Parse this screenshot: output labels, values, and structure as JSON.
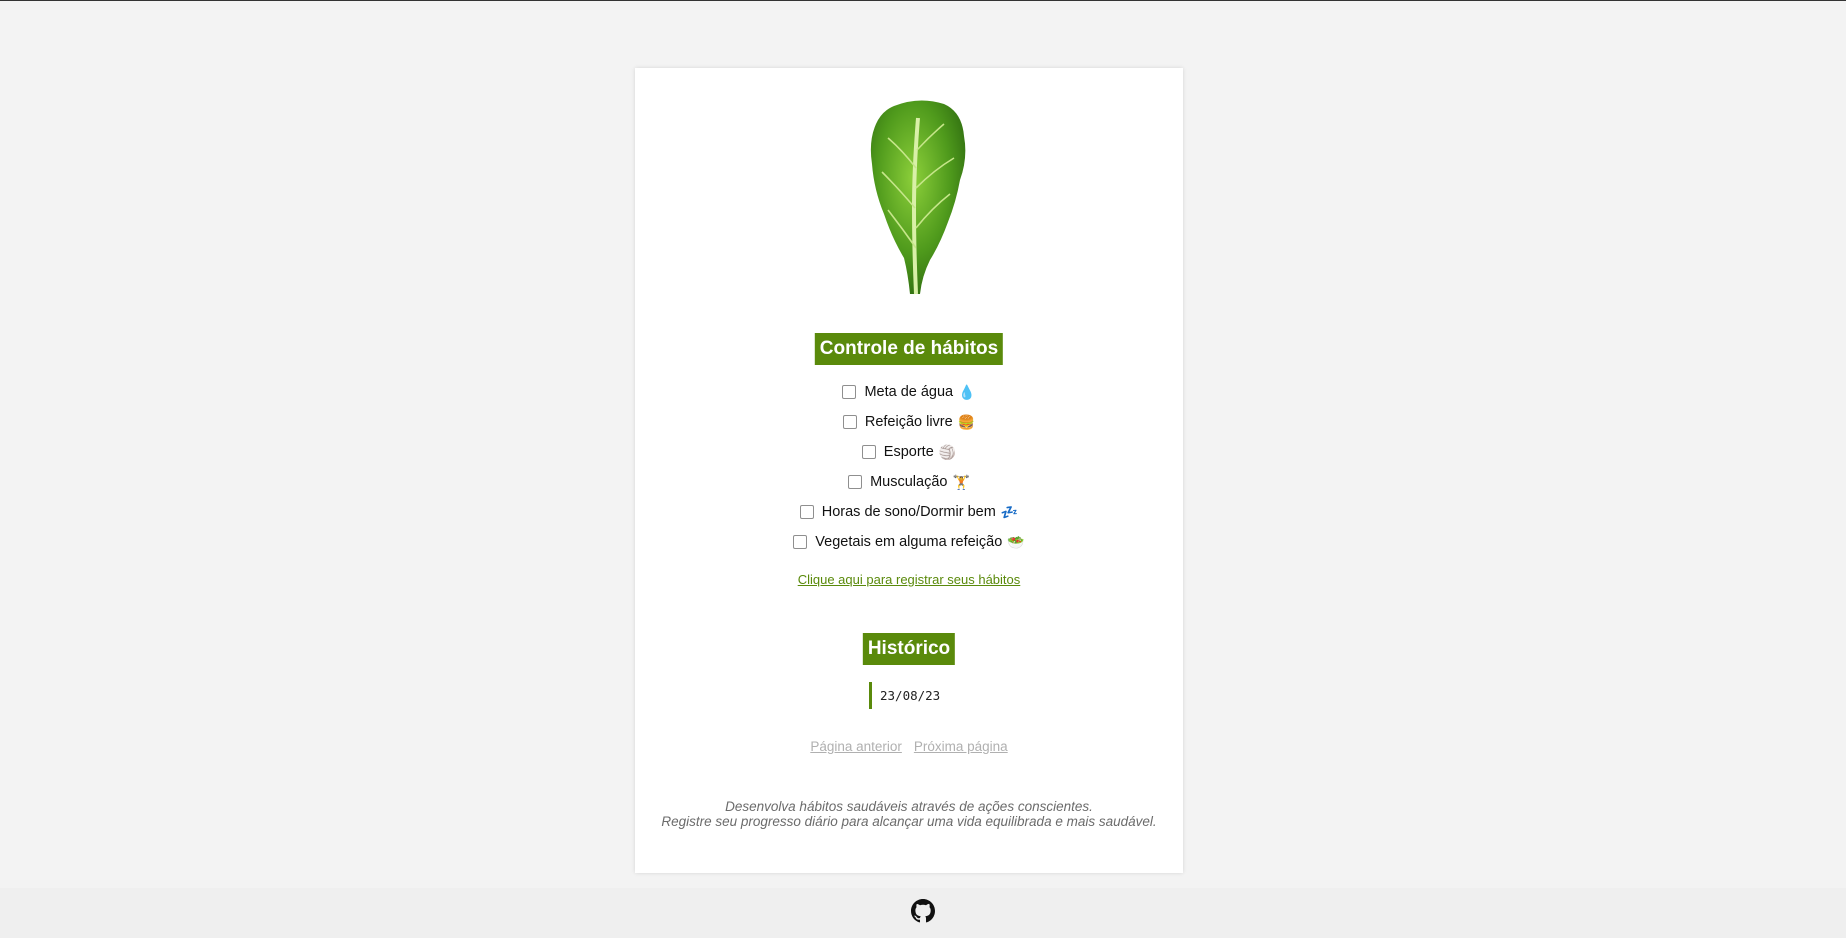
{
  "header": {
    "title": "Controle de hábitos"
  },
  "habits": [
    {
      "label": "Meta de água",
      "icon": "water-drop-icon",
      "checked": false
    },
    {
      "label": "Refeição livre",
      "icon": "burger-icon",
      "checked": false
    },
    {
      "label": "Esporte",
      "icon": "volleyball-icon",
      "checked": false
    },
    {
      "label": "Musculação",
      "icon": "weightlifter-icon",
      "checked": false
    },
    {
      "label": "Horas de sono/Dormir bem",
      "icon": "zzz-sleep-icon",
      "checked": false
    },
    {
      "label": "Vegetais em alguma refeição",
      "icon": "salad-icon",
      "checked": false
    }
  ],
  "register_link": "Clique aqui para registrar seus hábitos",
  "history": {
    "title": "Histórico",
    "entries": [
      "23/08/23"
    ]
  },
  "pagination": {
    "prev": "Página anterior",
    "next": "Próxima página"
  },
  "footer": {
    "line1": "Desenvolva hábitos saudáveis através de ações conscientes.",
    "line2": "Registre seu progresso diário para alcançar uma vida equilibrada e mais saudável."
  },
  "colors": {
    "accent": "#5a8a0b",
    "background": "#f3f3f3",
    "card": "#ffffff"
  },
  "bottom_bar": {
    "icon": "github-icon"
  }
}
